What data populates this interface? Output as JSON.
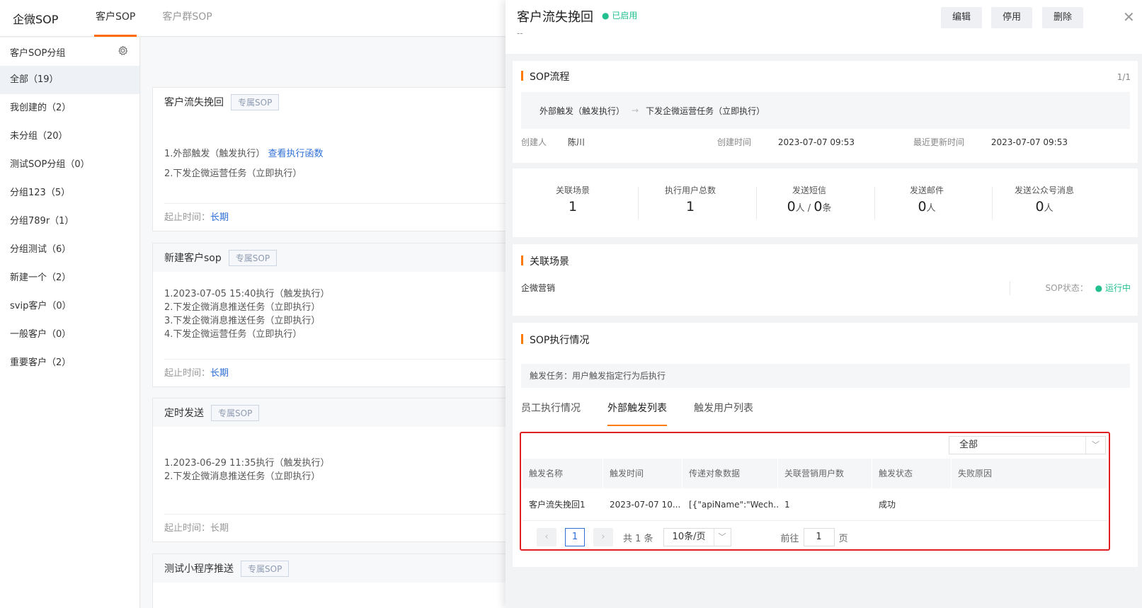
{
  "topnav": {
    "brand": "企微SOP",
    "tabs": [
      "客户SOP",
      "客户群SOP"
    ]
  },
  "sidebar": {
    "title": "客户SOP分组",
    "items": [
      "全部（19）",
      "我创建的（2）",
      "未分组（20）",
      "测试SOP分组（0）",
      "分组123（5）",
      "分组789r（1）",
      "分组测试（6）",
      "新建一个（2）",
      "svip客户（0）",
      "一般客户（0）",
      "重要客户（2）"
    ]
  },
  "cards": [
    {
      "title": "客户流失挽回",
      "badge": "专属SOP",
      "lines": [
        "1.外部触发（触发执行）",
        "2.下发企微运营任务（立即执行）"
      ],
      "line_link": "查看执行函数",
      "foot_label": "起止时间：",
      "foot_value": "长期"
    },
    {
      "title": "新建客户sop",
      "badge": "专属SOP",
      "lines": [
        "1.2023-07-05 15:40执行（触发执行）",
        "2.下发企微消息推送任务（立即执行）",
        "3.下发企微消息推送任务（立即执行）",
        "4.下发企微运营任务（立即执行）"
      ],
      "foot_label": "起止时间：",
      "foot_value": "长期"
    },
    {
      "title": "定时发送",
      "badge": "专属SOP",
      "lines": [
        "1.2023-06-29 11:35执行（触发执行）",
        "2.下发企微消息推送任务（立即执行）"
      ],
      "foot_label": "起止时间：",
      "foot_value": "长期"
    },
    {
      "title": "测试小程序推送",
      "badge": "专属SOP"
    }
  ],
  "panel": {
    "title": "客户流失挽回",
    "status": "已启用",
    "subtitle": "--",
    "buttons": {
      "edit": "编辑",
      "disable": "停用",
      "delete": "删除"
    },
    "close": "✕",
    "flow": {
      "section_title": "SOP流程",
      "page": "1/1",
      "steps": [
        "外部触发（触发执行）",
        "下发企微运营任务（立即执行）"
      ],
      "creator_label": "创建人",
      "creator": "陈川",
      "created_label": "创建时间",
      "created": "2023-07-07 09:53",
      "updated_label": "最近更新时间",
      "updated": "2023-07-07 09:53"
    },
    "stats": [
      {
        "label": "关联场景",
        "value": "1"
      },
      {
        "label": "执行用户总数",
        "value": "1"
      },
      {
        "label": "发送短信",
        "value": "0",
        "unit": "人",
        "sep": " / ",
        "value2": "0",
        "unit2": "条"
      },
      {
        "label": "发送邮件",
        "value": "0",
        "unit": "人"
      },
      {
        "label": "发送公众号消息",
        "value": "0",
        "unit": "人"
      }
    ],
    "scene": {
      "section_title": "关联场景",
      "name": "企微营销",
      "status_label": "SOP状态：",
      "status": "运行中"
    },
    "execution": {
      "section_title": "SOP执行情况",
      "trigger_note": "触发任务：用户触发指定行为后执行",
      "tabs": [
        "员工执行情况",
        "外部触发列表",
        "触发用户列表"
      ],
      "filter": "全部",
      "columns": [
        "触发名称",
        "触发时间",
        "传递对象数据",
        "关联营销用户数",
        "触发状态",
        "失败原因"
      ],
      "rows": [
        [
          "客户流失挽回1",
          "2023-07-07 10...",
          "[{\"apiName\":\"Wech...",
          "1",
          "成功",
          ""
        ]
      ],
      "pager": {
        "current": "1",
        "total": "共 1 条",
        "size": "10条/页",
        "goto_label": "前往",
        "goto_value": "1",
        "page_unit": "页"
      }
    }
  },
  "colors": {
    "accent": "#ff7a00",
    "link": "#2f6fd6",
    "success": "#22c08f",
    "highlight": "#e02020"
  }
}
